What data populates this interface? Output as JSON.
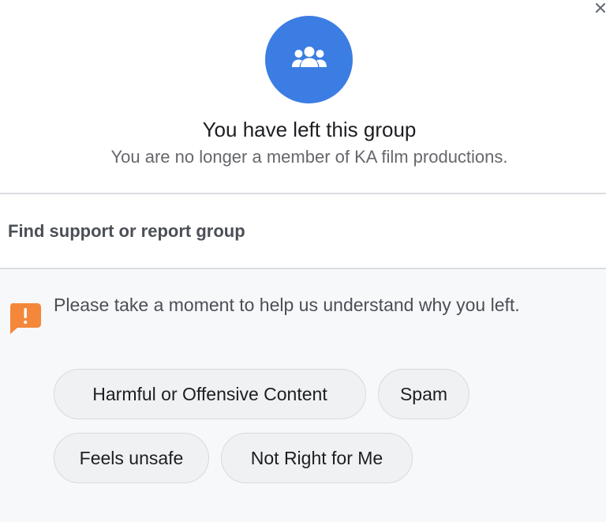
{
  "dialog": {
    "close_icon": "close-icon",
    "avatar_icon": "group-icon",
    "accent_color": "#3b7de3",
    "title": "You have left this group",
    "subtitle": "You are no longer a member of KA film productions."
  },
  "support": {
    "heading": "Find support or report group"
  },
  "feedback": {
    "icon": "alert-icon",
    "icon_color": "#f4873a",
    "prompt": "Please take a moment to help us understand why you left.",
    "reasons": [
      "Harmful or Offensive Content",
      "Spam",
      "Feels unsafe",
      "Not Right for Me"
    ]
  }
}
